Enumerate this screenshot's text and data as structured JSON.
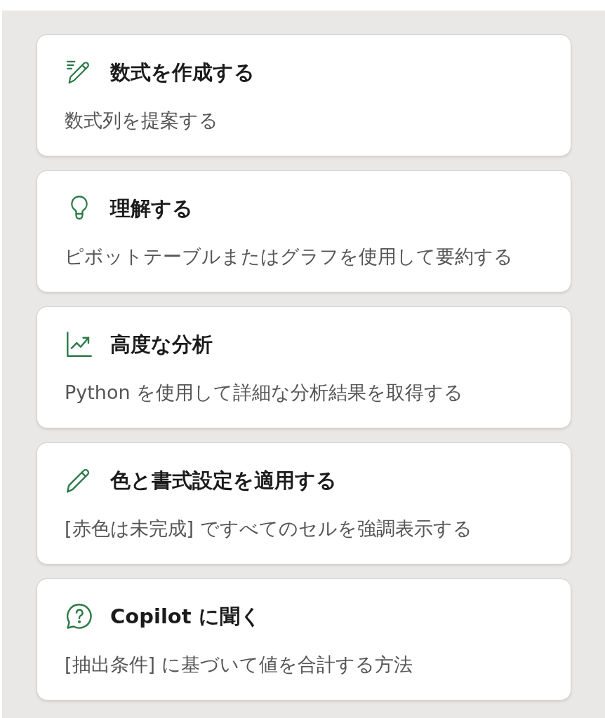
{
  "cards": [
    {
      "kind": "formula",
      "title": "数式を作成する",
      "description": "数式列を提案する"
    },
    {
      "kind": "insight",
      "title": "理解する",
      "description": "ピボットテーブルまたはグラフを使用して要約する"
    },
    {
      "kind": "analysis",
      "title": "高度な分析",
      "description": "Python を使用して詳細な分析結果を取得する"
    },
    {
      "kind": "format",
      "title": "色と書式設定を適用する",
      "description": "[赤色は未完成] ですべてのセルを強調表示する"
    },
    {
      "kind": "ask",
      "title": "Copilot に聞く",
      "description": "[抽出条件] に基づいて値を合計する方法"
    }
  ]
}
